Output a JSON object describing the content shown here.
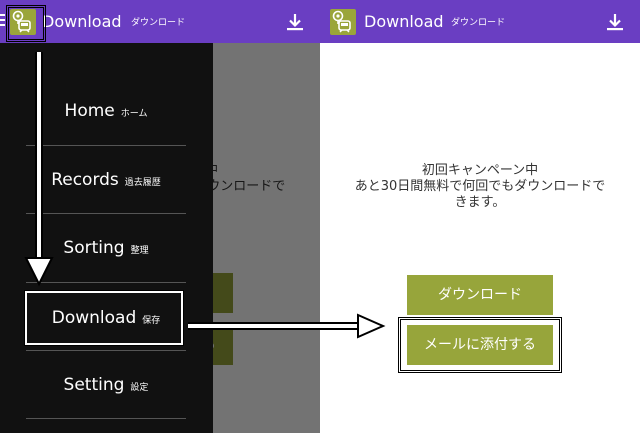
{
  "app": {
    "title": "Download",
    "subtitle": "ダウンロード"
  },
  "icons": {
    "menu": "hamburger-icon",
    "app": "train-map-pin-icon",
    "action": "download-icon"
  },
  "colors": {
    "appbar": "#6a3ec2",
    "button": "#97a53b",
    "drawer": "#111111"
  },
  "content": {
    "campaign_line1": "初回キャンペーン中",
    "campaign_line2": "あと30日間無料で何回でもダウンロードで",
    "campaign_line3": "きます。",
    "download_button": "ダウンロード",
    "mail_button": "メールに添付する"
  },
  "drawer": {
    "items": [
      {
        "label": "Home",
        "sub": "ホーム"
      },
      {
        "label": "Records",
        "sub": "過去履歴"
      },
      {
        "label": "Sorting",
        "sub": "整理"
      },
      {
        "label": "Download",
        "sub": "保存"
      },
      {
        "label": "Setting",
        "sub": "設定"
      }
    ]
  }
}
